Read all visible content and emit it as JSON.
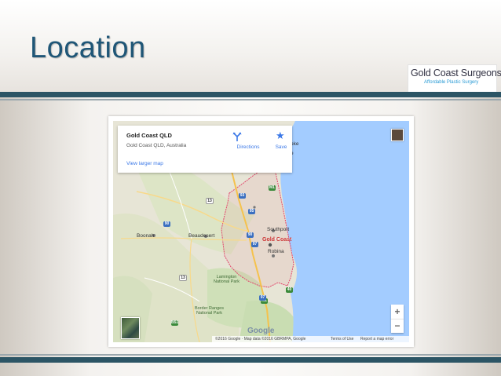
{
  "slide": {
    "title": "Location"
  },
  "logo": {
    "name": "Gold Coast Surgeons",
    "tagline": "Affordable Plastic Surgery"
  },
  "map": {
    "place": {
      "name": "Gold Coast QLD",
      "address": "Gold Coast QLD, Australia"
    },
    "view_larger_label": "View larger map",
    "actions": {
      "directions_label": "Directions",
      "save_label": "Save"
    },
    "labels": {
      "southport": "Southport",
      "gold_coast": "Gold Coast",
      "robina": "Robina",
      "boonah": "Boonah",
      "beaudesert": "Beaudesert",
      "lamington": "Lamington\nNational Park",
      "border_ranges": "Border Ranges\nNational Park",
      "logan_partial": "oke",
      "e_partial": "e"
    },
    "shields": {
      "m1_a": "M1",
      "m1_b": "M1",
      "n93": "93",
      "n95": "95",
      "n90": "90",
      "n97": "97",
      "n97b": "97",
      "n13a": "13",
      "n13b": "13",
      "n40": "40",
      "b51": "B51",
      "n90b": "90"
    },
    "zoom": {
      "in": "+",
      "out": "−"
    },
    "google_logo": "Google",
    "footer": {
      "attribution": "©2016 Google · Map data ©2016 GBRMPA, Google",
      "terms": "Terms of Use",
      "report": "Report a map error"
    },
    "colors": {
      "water": "#a3ccff",
      "land": "#e8e6d8",
      "boundary": "#e2456b",
      "link": "#3b78e7"
    }
  }
}
